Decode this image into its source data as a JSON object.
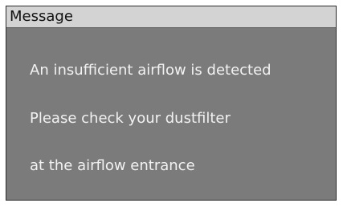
{
  "dialog": {
    "title": "Message",
    "lines": [
      "An insufficient airflow is detected",
      "Please check your dustfilter",
      "at the airflow entrance"
    ]
  },
  "colors": {
    "title_bar": "#d3d3d3",
    "body": "#7b7b7b",
    "text": "#f2f2f2"
  }
}
